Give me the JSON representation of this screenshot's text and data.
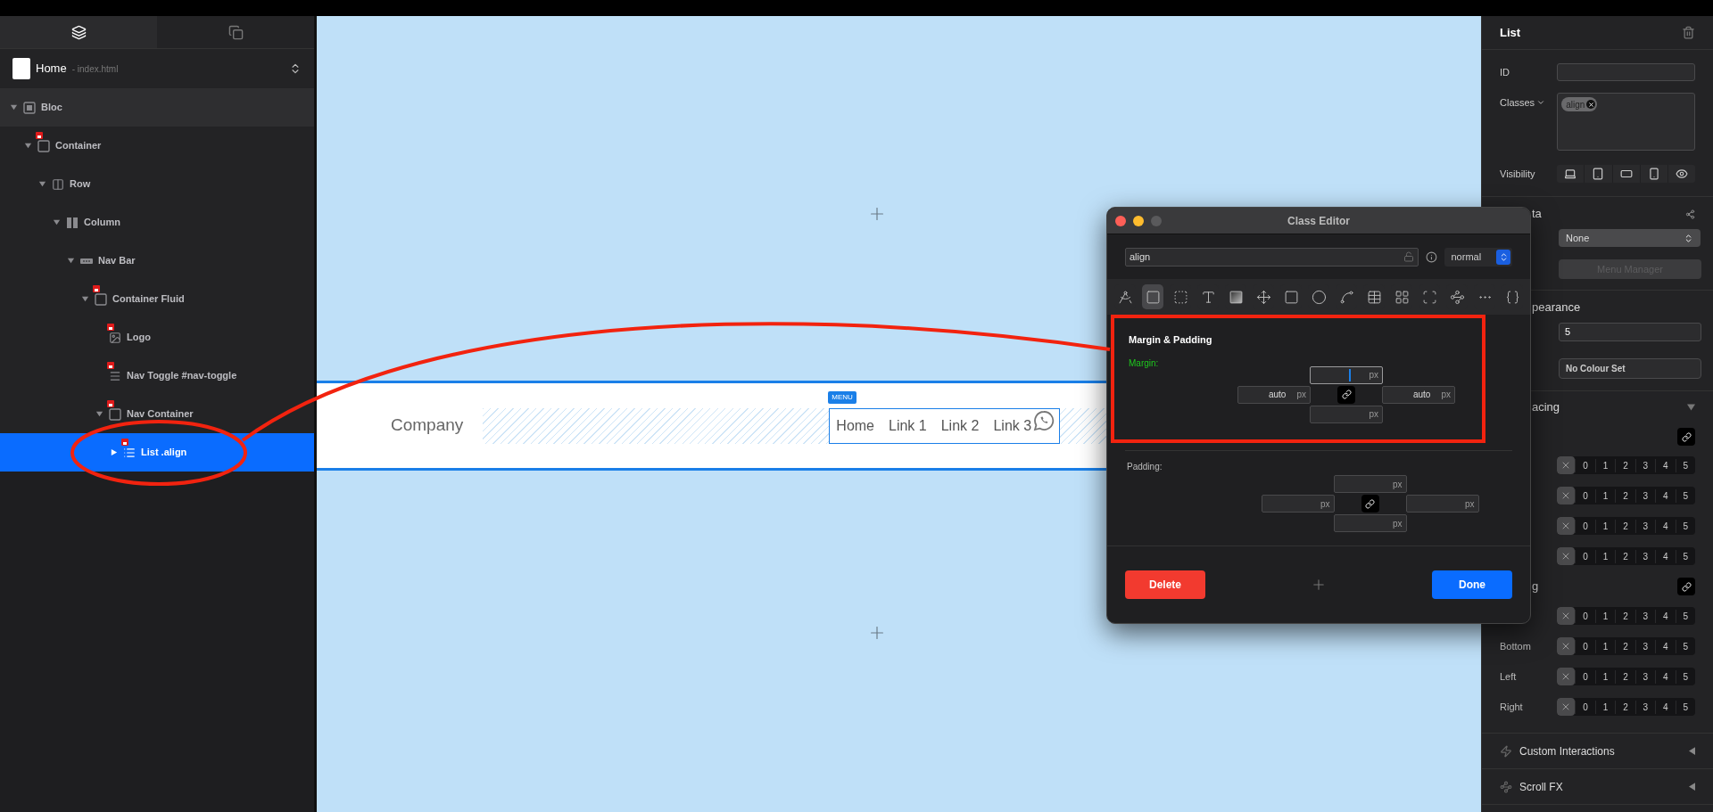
{
  "top_tabs": [
    {
      "kind": "layers",
      "selected": true
    },
    {
      "kind": "pages",
      "selected": false
    }
  ],
  "page_selector": {
    "title": "Home",
    "file": "- index.html"
  },
  "tree": [
    {
      "label": "Bloc",
      "kind": "bloc",
      "locked": false,
      "expanded": true,
      "selected": false,
      "children": [
        {
          "label": "Container",
          "kind": "box",
          "locked": true,
          "expanded": true,
          "selected": false,
          "children": [
            {
              "label": "Row",
              "kind": "row",
              "locked": false,
              "expanded": true,
              "selected": false,
              "children": [
                {
                  "label": "Column",
                  "kind": "column",
                  "locked": false,
                  "expanded": true,
                  "selected": false,
                  "children": [
                    {
                      "label": "Nav Bar",
                      "kind": "navbar",
                      "locked": false,
                      "expanded": true,
                      "selected": false,
                      "children": [
                        {
                          "label": "Container Fluid",
                          "kind": "box",
                          "locked": true,
                          "expanded": true,
                          "selected": false,
                          "children": [
                            {
                              "label": "Logo",
                              "kind": "image",
                              "locked": true,
                              "selected": false
                            },
                            {
                              "label": "Nav Toggle #nav-toggle",
                              "kind": "toggle",
                              "locked": true,
                              "selected": false
                            },
                            {
                              "label": "Nav Container",
                              "kind": "box",
                              "locked": true,
                              "expanded": true,
                              "selected": false,
                              "children": [
                                {
                                  "label": "List .align",
                                  "kind": "list",
                                  "locked": true,
                                  "expanded": false,
                                  "selected": true
                                }
                              ]
                            }
                          ]
                        }
                      ]
                    }
                  ]
                }
              ]
            }
          ]
        }
      ]
    }
  ],
  "canvas": {
    "brand": "Company",
    "menu_badge": "MENU",
    "links": [
      "Home",
      "Link 1",
      "Link 2",
      "Link 3"
    ]
  },
  "inspector": {
    "title": "List",
    "id_label": "ID",
    "classes_label": "Classes",
    "class_tags": [
      "align"
    ],
    "visibility_label": "Visibility",
    "visibility": [
      {
        "kind": "laptop",
        "on": true
      },
      {
        "kind": "tablet",
        "on": true
      },
      {
        "kind": "landscape",
        "on": true
      },
      {
        "kind": "phone",
        "on": true
      },
      {
        "kind": "eye",
        "on": true
      }
    ],
    "meta_label": "ta",
    "menu_select": "None",
    "menu_manager": {
      "label": "Menu Manager",
      "disabled": true
    },
    "appearance_label": "pearance",
    "opacity_value": "5",
    "colour_button": "No Colour Set",
    "spacing_label": "acing",
    "margin_rows": [
      {
        "options": [
          "0",
          "1",
          "2",
          "3",
          "4",
          "5"
        ],
        "cleared": true
      },
      {
        "options": [
          "0",
          "1",
          "2",
          "3",
          "4",
          "5"
        ],
        "cleared": true
      },
      {
        "options": [
          "0",
          "1",
          "2",
          "3",
          "4",
          "5"
        ],
        "cleared": true
      },
      {
        "options": [
          "0",
          "1",
          "2",
          "3",
          "4",
          "5"
        ],
        "cleared": true
      }
    ],
    "padding_label": "g",
    "padding_rows": [
      {
        "options": [
          "0",
          "1",
          "2",
          "3",
          "4",
          "5"
        ],
        "cleared": true
      },
      {
        "label": "Bottom",
        "options": [
          "0",
          "1",
          "2",
          "3",
          "4",
          "5"
        ],
        "cleared": true
      },
      {
        "label": "Left",
        "options": [
          "0",
          "1",
          "2",
          "3",
          "4",
          "5"
        ],
        "cleared": true
      },
      {
        "label": "Right",
        "options": [
          "0",
          "1",
          "2",
          "3",
          "4",
          "5"
        ],
        "cleared": true
      }
    ],
    "sections": [
      {
        "kind": "bolt",
        "label": "Custom Interactions"
      },
      {
        "kind": "fx",
        "label": "Scroll FX"
      }
    ]
  },
  "dialog": {
    "title": "Class Editor",
    "class_name": "align",
    "state": "normal",
    "tools": [
      {
        "kind": "compass",
        "selected": false
      },
      {
        "kind": "box",
        "selected": true
      },
      {
        "kind": "dashed",
        "selected": false
      },
      {
        "kind": "text",
        "selected": false
      },
      {
        "kind": "gradient",
        "selected": false
      },
      {
        "kind": "move",
        "selected": false
      },
      {
        "kind": "shadow",
        "selected": false
      },
      {
        "kind": "circles",
        "selected": false
      },
      {
        "kind": "curve",
        "selected": false
      },
      {
        "kind": "table",
        "selected": false
      },
      {
        "kind": "grid",
        "selected": false
      },
      {
        "kind": "transform",
        "selected": false
      },
      {
        "kind": "scatter",
        "selected": false
      },
      {
        "kind": "more",
        "selected": false
      },
      {
        "kind": "code",
        "selected": false
      }
    ],
    "section_title": "Margin & Padding",
    "margin": {
      "label": "Margin:",
      "top": {
        "unit": "px",
        "focused": true
      },
      "left": {
        "value": "auto",
        "unit": "px",
        "focused": false
      },
      "right": {
        "value": "auto",
        "unit": "px",
        "focused": false
      },
      "bottom": {
        "unit": "px",
        "focused": false
      }
    },
    "padding": {
      "label": "Padding:",
      "top": {
        "unit": "px",
        "focused": false
      },
      "left": {
        "unit": "px",
        "focused": false
      },
      "right": {
        "unit": "px",
        "focused": false
      },
      "bottom": {
        "unit": "px",
        "focused": false
      }
    },
    "delete_label": "Delete",
    "done_label": "Done"
  }
}
